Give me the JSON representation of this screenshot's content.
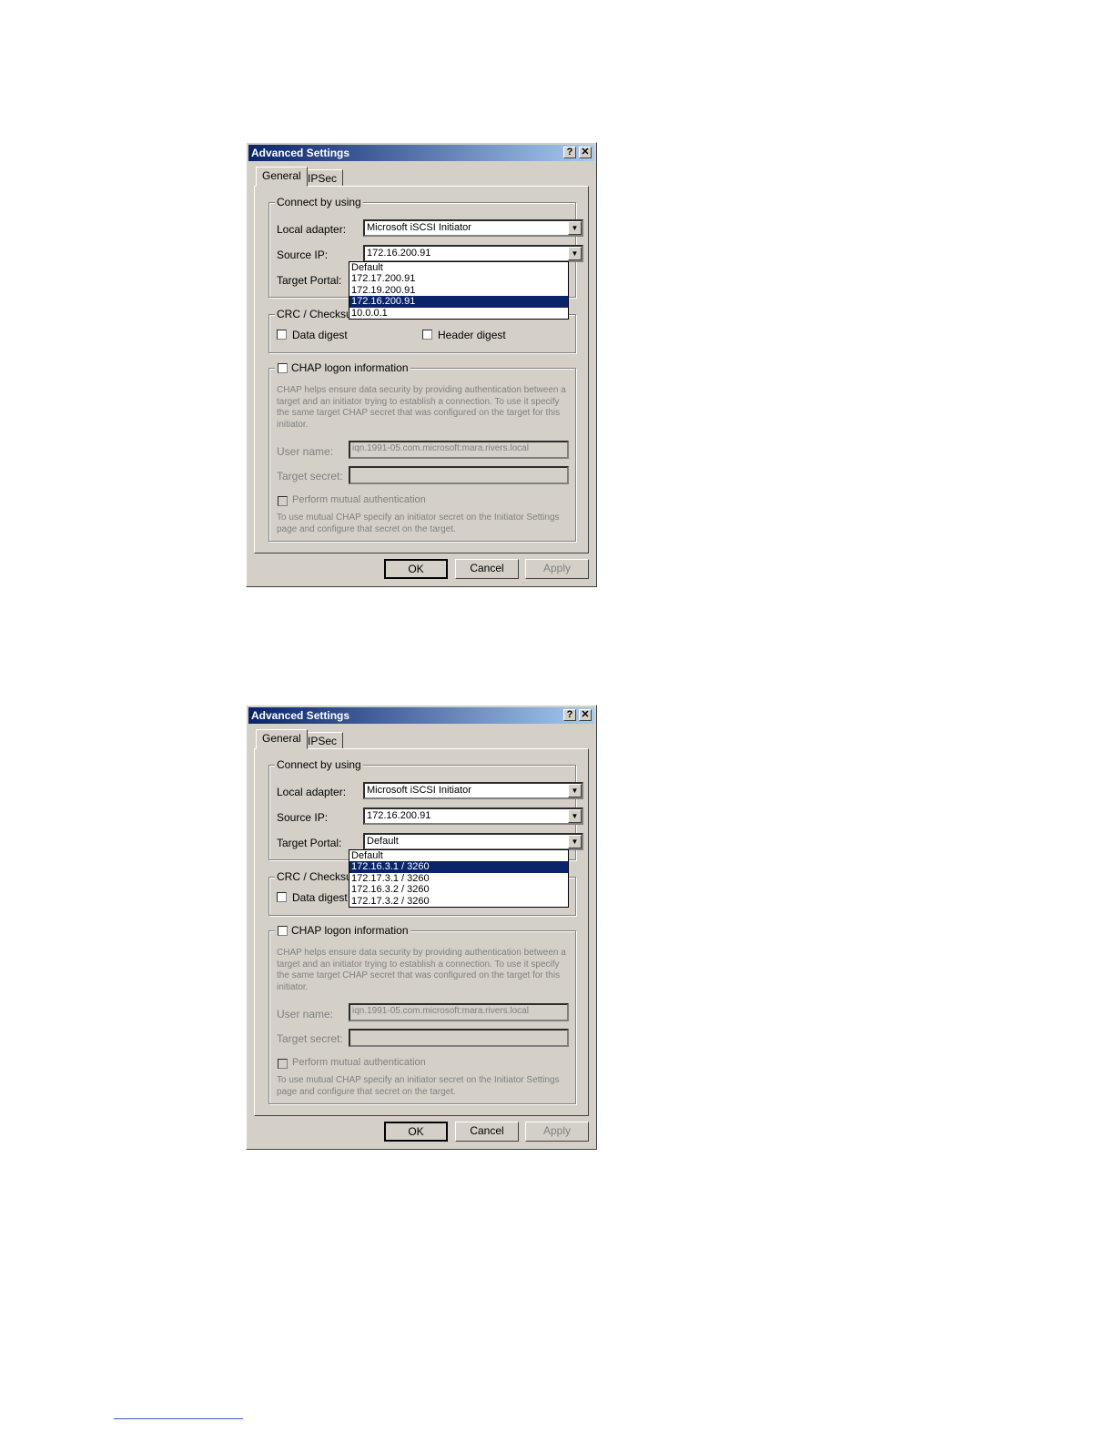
{
  "dialog1": {
    "title": "Advanced Settings",
    "help": "?",
    "close": "✕",
    "tabs": [
      "General",
      "IPSec"
    ],
    "connect_legend": "Connect by using",
    "local_adapter_label": "Local adapter:",
    "local_adapter_value": "Microsoft iSCSI Initiator",
    "source_ip_label": "Source IP:",
    "source_ip_value": "172.16.200.91",
    "target_portal_label": "Target Portal:",
    "dropdown_items": [
      "Default",
      "172.17.200.91",
      "172.19.200.91",
      "172.16.200.91",
      "10.0.0.1"
    ],
    "crc_legend": "CRC / Checksum",
    "data_digest": "Data digest",
    "header_digest": "Header digest",
    "chap_legend": "CHAP logon information",
    "chap_text": "CHAP helps ensure data security by providing authentication between a target and an initiator trying to establish a connection. To use it specify the same target CHAP secret that was configured on the target for this initiator.",
    "user_name_label": "User name:",
    "user_name_value": "iqn.1991-05.com.microsoft:mara.rivers.local",
    "target_secret_label": "Target secret:",
    "mutual_auth": "Perform mutual authentication",
    "mutual_text": "To use mutual CHAP specify an initiator secret on the Initiator Settings page and configure that secret on the target.",
    "ok": "OK",
    "cancel": "Cancel",
    "apply": "Apply"
  },
  "dialog2": {
    "title": "Advanced Settings",
    "help": "?",
    "close": "✕",
    "tabs": [
      "General",
      "IPSec"
    ],
    "connect_legend": "Connect by using",
    "local_adapter_label": "Local adapter:",
    "local_adapter_value": "Microsoft iSCSI Initiator",
    "source_ip_label": "Source IP:",
    "source_ip_value": "172.16.200.91",
    "target_portal_label": "Target Portal:",
    "target_portal_value": "Default",
    "dropdown_items": [
      "Default",
      "172.16.3.1 / 3260",
      "172.17.3.1 / 3260",
      "172.16.3.2 / 3260",
      "172.17.3.2 / 3260"
    ],
    "crc_legend": "CRC / Checksum",
    "data_digest": "Data digest",
    "chap_legend": "CHAP logon information",
    "chap_text": "CHAP helps ensure data security by providing authentication between a target and an initiator trying to establish a connection. To use it specify the same target CHAP secret that was configured on the target for this initiator.",
    "user_name_label": "User name:",
    "user_name_value": "iqn.1991-05.com.microsoft:mara.rivers.local",
    "target_secret_label": "Target secret:",
    "mutual_auth": "Perform mutual authentication",
    "mutual_text": "To use mutual CHAP specify an initiator secret on the Initiator Settings page and configure that secret on the target.",
    "ok": "OK",
    "cancel": "Cancel",
    "apply": "Apply"
  }
}
